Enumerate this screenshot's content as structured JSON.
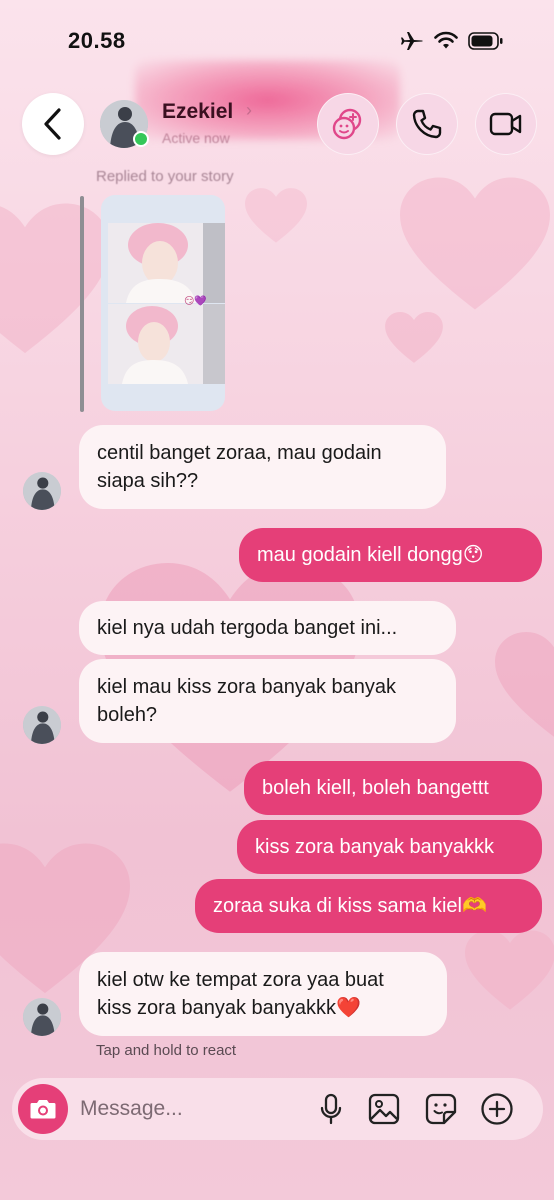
{
  "status_bar": {
    "time": "20.58"
  },
  "header": {
    "contact_name": "Ezekiel",
    "active_status": "Active now"
  },
  "story_reply": {
    "label": "Replied to your story"
  },
  "messages": [
    {
      "side": "in",
      "lines": [
        "centil banget zoraa, mau godain",
        "siapa sih??"
      ]
    },
    {
      "side": "out",
      "lines": [
        "mau godain kiell dongg😯"
      ]
    },
    {
      "side": "in",
      "lines": [
        "kiel nya udah tergoda banget ini..."
      ]
    },
    {
      "side": "in",
      "lines": [
        "kiel mau kiss zora banyak banyak",
        "boleh?"
      ]
    },
    {
      "side": "out",
      "lines": [
        "boleh kiell, boleh bangettt"
      ]
    },
    {
      "side": "out",
      "lines": [
        "kiss zora banyak banyakkk"
      ]
    },
    {
      "side": "out",
      "lines": [
        "zoraa suka di kiss sama kiel🫶"
      ]
    },
    {
      "side": "in",
      "lines": [
        "kiel otw ke tempat zora yaa buat",
        "kiss zora banyak banyakkk❤️"
      ]
    }
  ],
  "hint": "Tap and hold to react",
  "composer": {
    "placeholder": "Message..."
  },
  "colors": {
    "accent": "#e53f78",
    "incoming_bubble": "#fdf3f5",
    "background": "#f6d0de"
  },
  "icons": [
    "back-chevron-icon",
    "effects-icon",
    "phone-icon",
    "video-icon",
    "camera-icon",
    "microphone-icon",
    "gallery-icon",
    "sticker-icon",
    "plus-icon"
  ]
}
